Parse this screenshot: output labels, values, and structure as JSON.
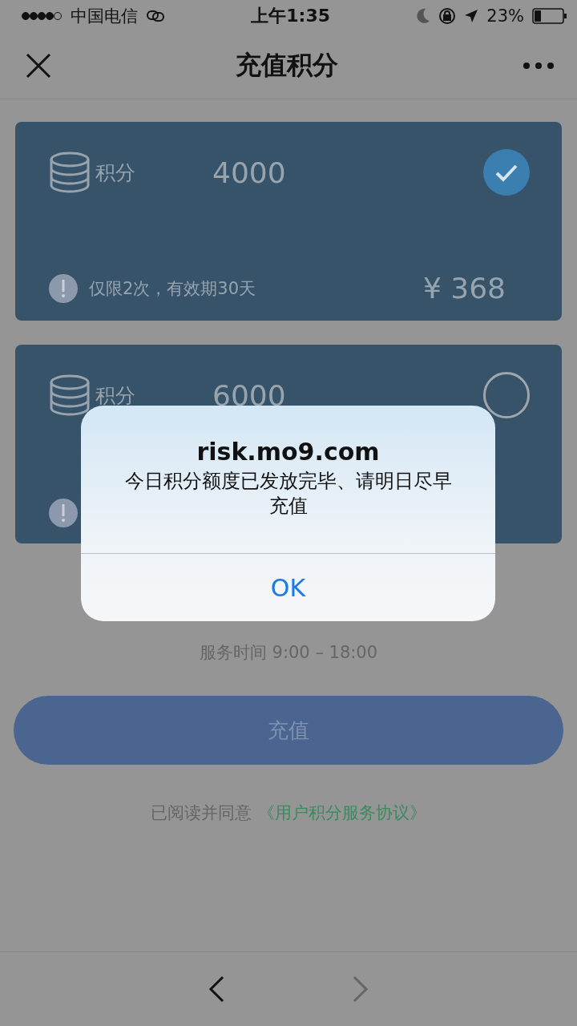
{
  "status_bar": {
    "carrier": "中国电信",
    "time": "上午1:35",
    "battery": "23%"
  },
  "nav": {
    "title": "充值积分"
  },
  "packages": [
    {
      "label": "积分",
      "points": "4000",
      "note": "仅限2次，有效期30天",
      "price": "¥ 368",
      "selected": true
    },
    {
      "label": "积分",
      "points": "6000",
      "selected": false
    }
  ],
  "service_hours": "服务时间 9:00 – 18:00",
  "submit_button": "充值",
  "agreement": {
    "text": "已阅读并同意",
    "link": "《用户积分服务协议》"
  },
  "dialog": {
    "title": "risk.mo9.com",
    "message": "今日积分额度已发放完毕、请明日尽早充值",
    "button": "OK"
  }
}
